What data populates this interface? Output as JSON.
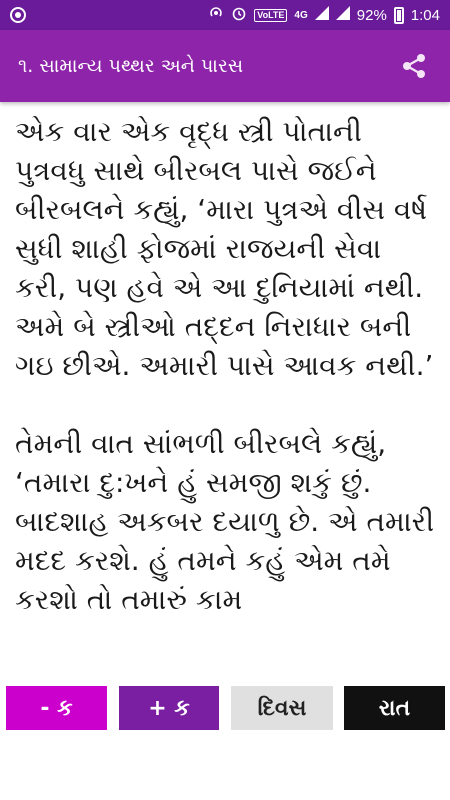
{
  "status_bar": {
    "network_label": "4G",
    "lte_label": "VoLTE",
    "battery_percent": "92%",
    "time": "1:04"
  },
  "app_bar": {
    "title": "૧. સામાન્ય પથ્થર અને પારસ",
    "share_icon": "share-icon"
  },
  "content": {
    "paragraphs": [
      "એક વાર એક વૃદ્ધ સ્ત્રી પોતાની પુત્રવધુ સાથે બીરબલ પાસે જઈને બીરબલને કહ્યું, ‘મારા પુત્રએ વીસ વર્ષ સુધી શાહી ફોજમાં રાજયની સેવા કરી, પણ હવે એ આ દુનિયામાં નથી. અમે બે સ્ત્રીઓ તદ્દન નિરાધાર બની ગઇ છીએ. અમારી પાસે આવક નથી.’",
      "તેમની વાત સાંભળી બીરબલે કહ્યું, ‘તમારા દુ:ખને હું સમજી શકું છું. બાદશાહ અકબર દયાળુ છે. એ તમારી મદદ કરશે. હું તમને કહું એમ તમે કરશો તો તમારું કામ"
    ]
  },
  "buttons": {
    "decrease_font": "- ક",
    "increase_font": "+ ક",
    "day_mode": "દિવસ",
    "night_mode": "રાત"
  },
  "colors": {
    "status_bar": "#6a1b9a",
    "app_bar": "#8e24aa",
    "btn_decrease": "#cc00cc",
    "btn_increase": "#7b1fa2",
    "btn_day": "#e0e0e0",
    "btn_night": "#111111"
  }
}
